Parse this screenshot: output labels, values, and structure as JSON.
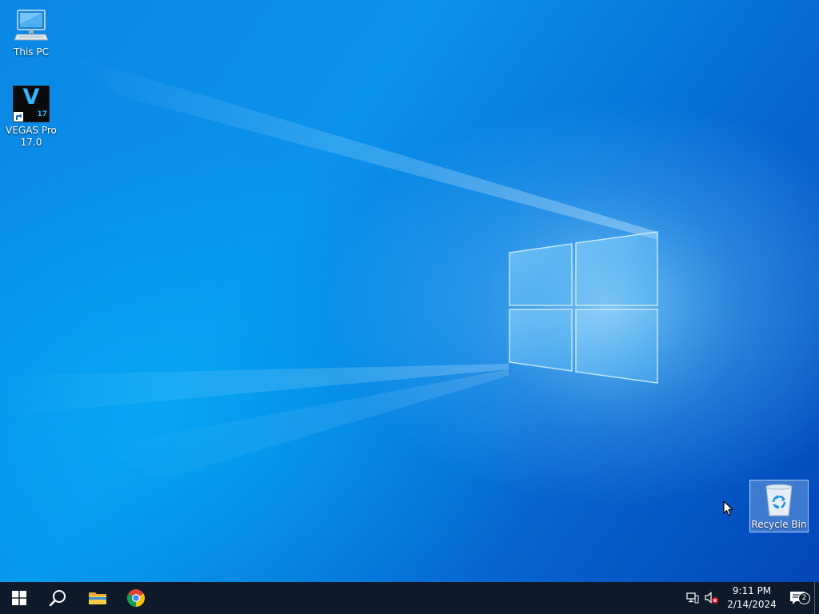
{
  "desktop": {
    "icons": {
      "this_pc": {
        "label": "This PC",
        "icon": "computer-icon"
      },
      "vegas": {
        "label_line1": "VEGAS Pro",
        "label_line2": "17.0",
        "logo_letter": "V",
        "logo_version": "17",
        "icon": "vegas-pro-icon"
      },
      "recycle_bin": {
        "label": "Recycle Bin",
        "icon": "recycle-bin-icon"
      }
    }
  },
  "taskbar": {
    "start": {
      "icon": "windows-logo-icon"
    },
    "search": {
      "icon": "search-icon"
    },
    "pinned": [
      {
        "name": "File Explorer",
        "icon": "folder-icon"
      },
      {
        "name": "Google Chrome",
        "icon": "chrome-icon"
      }
    ],
    "tray": {
      "network_icon": "network-icon",
      "volume_icon": "volume-muted-icon",
      "time": "9:11 PM",
      "date": "2/14/2024",
      "notifications_count": "2",
      "notifications_icon": "action-center-icon"
    }
  },
  "colors": {
    "taskbar": "#0c1a2a",
    "wallpaper_accent": "#0a87e6",
    "logo_glow": "#bfe6ff"
  }
}
